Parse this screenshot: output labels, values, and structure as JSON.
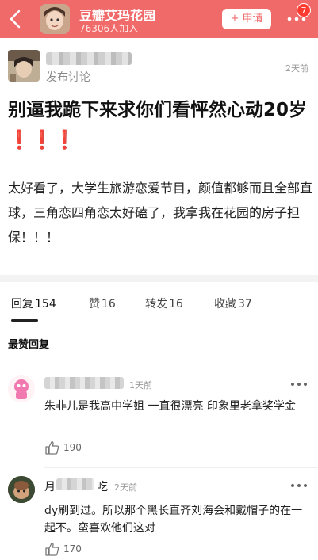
{
  "header": {
    "group_name": "豆瓣艾玛花园",
    "member_count": "76306人加入",
    "join_label": "+ 申请",
    "badge_count": "7",
    "accent_color": "#f06a6a"
  },
  "post": {
    "action": "发布讨论",
    "time": "2天前",
    "title": "别逼我跪下来求你们看怦然心动20岁❗️❗️❗️",
    "body": "太好看了，大学生旅游恋爱节目，颜值都够而且全部直球，三角恋四角恋太好磕了，我拿我在花园的房子担保！！！"
  },
  "tabs": [
    {
      "label": "回复",
      "count": "154"
    },
    {
      "label": "赞",
      "count": "16"
    },
    {
      "label": "转发",
      "count": "16"
    },
    {
      "label": "收藏",
      "count": "37"
    }
  ],
  "section_label": "最赞回复",
  "comments": [
    {
      "time": "1天前",
      "text": "朱非儿是我高中学姐 一直很漂亮 印象里老拿奖学金",
      "likes": "190"
    },
    {
      "name_prefix": "月",
      "name_suffix": "吃",
      "time": "2天前",
      "text": "dy刷到过。所以那个黑长直齐刘海会和戴帽子的在一起不。蛮喜欢他们这对",
      "likes": "170"
    }
  ]
}
